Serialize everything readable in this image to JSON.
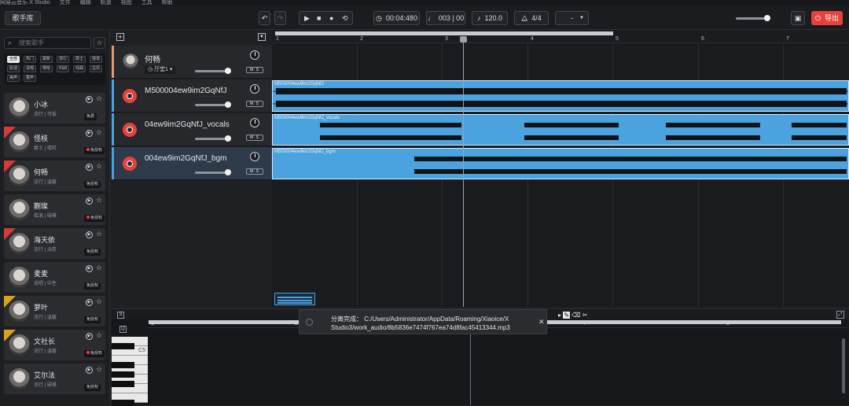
{
  "app": {
    "title": "网易云音乐·X Studio",
    "menu": [
      "文件",
      "编辑",
      "轨道",
      "视图",
      "工具",
      "帮助"
    ]
  },
  "toolbar": {
    "library_label": "歌手库",
    "time": "00:04:480",
    "bar_beat": "003 | 00",
    "tempo": "120.0",
    "time_signature": "4/4",
    "key_select": "-",
    "export_label": "导出"
  },
  "sidebar": {
    "search_placeholder": "搜索歌手",
    "tags": [
      "全部",
      "热门",
      "最新",
      "流行",
      "爵士",
      "摇滚",
      "民谣",
      "说唱",
      "嘻哈",
      "R&B",
      "戏曲",
      "古风",
      "美声",
      "童声"
    ],
    "singers": [
      {
        "name": "小冰",
        "style": "流行 | 可爱",
        "badge": "免费",
        "ribbon": ""
      },
      {
        "name": "怪枝",
        "style": "爵士 | 嘻哈",
        "badge": "免授权",
        "ribbon": "hot"
      },
      {
        "name": "何畅",
        "style": "流行 | 温暖",
        "badge": "免授权",
        "ribbon": "hot"
      },
      {
        "name": "蒯璨",
        "style": "摇滚 | 磁嗓",
        "badge": "免授权",
        "ribbon": ""
      },
      {
        "name": "海天依",
        "style": "流行 | 治愈",
        "badge": "免授权",
        "ribbon": "hot"
      },
      {
        "name": "麦麦",
        "style": "说唱 | 中性",
        "badge": "免授权",
        "ribbon": ""
      },
      {
        "name": "萝叶",
        "style": "流行 | 温暖",
        "badge": "免授权",
        "ribbon": "new"
      },
      {
        "name": "文社长",
        "style": "流行 | 温暖",
        "badge": "免授权",
        "ribbon": "new"
      },
      {
        "name": "艾尔法",
        "style": "流行 | 磁嗓",
        "badge": "免授权",
        "ribbon": ""
      }
    ]
  },
  "tracks": [
    {
      "name": "何畅",
      "preset": "厅堂1",
      "kind": "vocal"
    },
    {
      "name": "M500004ew9im2GqNfJ",
      "kind": "audio",
      "region_label": "M500004ew9im2GqNfJ"
    },
    {
      "name": "04ew9im2GqNfJ_vocals",
      "kind": "audio",
      "region_label": "M500004ew9im2GqNfJ_vocals"
    },
    {
      "name": "004ew9im2GqNfJ_bgm",
      "kind": "audio",
      "region_label": "M500004ew9im2GqNfJ_bgm"
    }
  ],
  "ruler": [
    "1",
    "2",
    "3",
    "4",
    "5",
    "6",
    "7"
  ],
  "editor": {
    "ruler": [
      "1",
      "2",
      "3",
      "4",
      "5"
    ],
    "key_label": "C5",
    "notification": "分离完成：  C:/Users/Administrator/AppData/Roaming/Xiaoice/X Studio3/work_audio/8b5836e7474f767ea74d8fac45413344.mp3"
  }
}
